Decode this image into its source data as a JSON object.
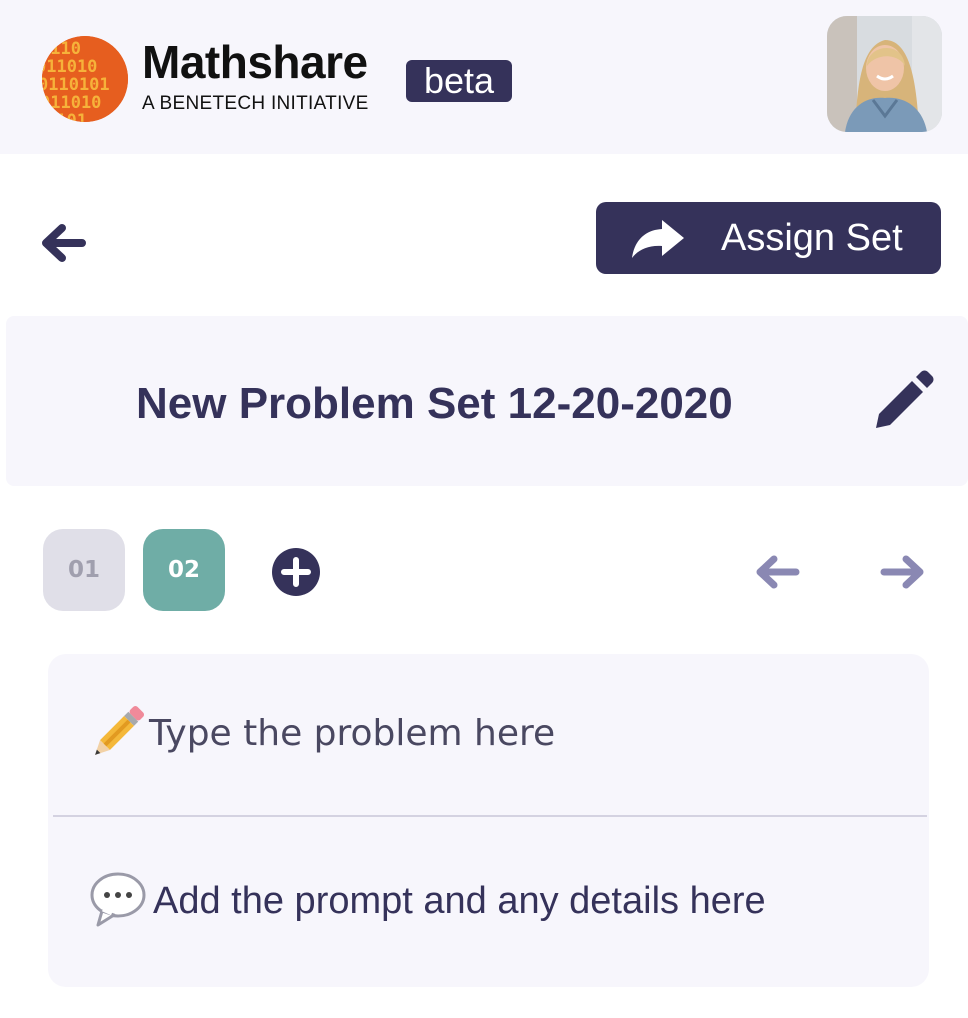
{
  "header": {
    "brand_name": "Mathshare",
    "brand_subtitle": "A BENETECH INITIATIVE",
    "badge": "beta",
    "logo_icon": "binary-globe-logo",
    "avatar_icon": "user-avatar"
  },
  "toolbar": {
    "back_icon": "arrow-left-icon",
    "assign_label": "Assign Set",
    "assign_icon": "share-icon"
  },
  "problem_set": {
    "title": "New Problem Set 12-20-2020",
    "edit_icon": "pencil-icon"
  },
  "problem_nav": {
    "tabs": [
      {
        "label": "01",
        "selected": false
      },
      {
        "label": "02",
        "selected": true
      }
    ],
    "add_icon": "plus-circle-icon",
    "prev_icon": "arrow-left-icon",
    "next_icon": "arrow-right-icon"
  },
  "editor": {
    "problem_placeholder": "Type the problem here",
    "problem_icon": "pencil-emoji",
    "prompt_placeholder": "Add the prompt and any details here",
    "prompt_icon": "speech-bubble-emoji"
  },
  "colors": {
    "primary": "#35325a",
    "selected_tab": "#6fada6",
    "unselected_tab": "#e0dfe8",
    "panel_background": "#f7f6fc",
    "nav_arrows": "#8a88b3",
    "logo_orange": "#e65e1f"
  }
}
